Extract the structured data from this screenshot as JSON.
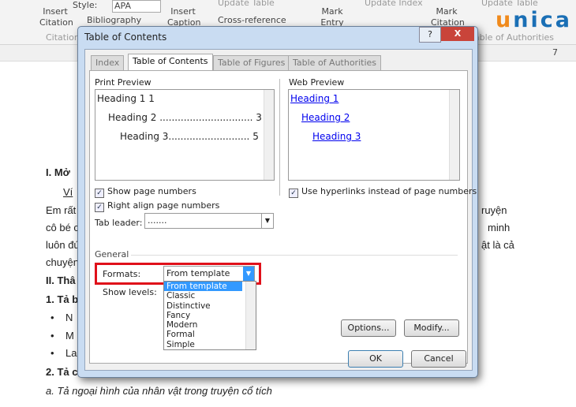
{
  "ribbon": {
    "style_label": "Style:",
    "style_value": "APA",
    "insert_citation": "Insert Citation",
    "bibliography": "Bibliography",
    "group_citations": "Citations",
    "insert_caption": "Insert Caption",
    "update_table_1": "Update Table",
    "cross_reference": "Cross-reference",
    "mark_entry": "Mark Entry",
    "update_index": "Update Index",
    "mark_citation": "Mark Citation",
    "update_table_2": "Update Table",
    "group_toa": "Table of Authorities",
    "ruler_num": "7"
  },
  "logo": "unica",
  "document": {
    "lines": [
      "I.  Mở",
      "Ví",
      "Em rất",
      "cô bé c",
      "luôn đú",
      "chuyện",
      "II.  Thâ",
      "1. Tả b",
      "N",
      "M",
      "La",
      "2. Tả c",
      "a. Tả ngoại hình của nhân vật trong truyện cổ tích"
    ],
    "right": [
      "ruyện",
      "minh",
      "ật là cả"
    ]
  },
  "dialog": {
    "title": "Table of Contents",
    "help": "?",
    "close": "X",
    "tabs": [
      "Index",
      "Table of Contents",
      "Table of Figures",
      "Table of Authorities"
    ],
    "print_preview": {
      "label": "Print Preview",
      "h1": "Heading 1 1",
      "h2": "Heading 2 ............................... 3",
      "h3": "Heading 3........................... 5"
    },
    "web_preview": {
      "label": "Web Preview",
      "h1": "Heading 1",
      "h2": "Heading 2",
      "h3": "Heading 3"
    },
    "show_page_numbers": "Show page numbers",
    "right_align": "Right align page numbers",
    "tab_leader_label": "Tab leader:",
    "tab_leader_value": ".......",
    "use_hyperlinks": "Use hyperlinks instead of page numbers",
    "general": "General",
    "formats_label": "Formats:",
    "formats_value": "From template",
    "show_levels_label": "Show levels:",
    "format_options": [
      "From template",
      "Classic",
      "Distinctive",
      "Fancy",
      "Modern",
      "Formal",
      "Simple"
    ],
    "options_btn": "Options...",
    "modify_btn": "Modify...",
    "ok_btn": "OK",
    "cancel_btn": "Cancel"
  },
  "colors": {
    "highlight": "#e0101a",
    "selection": "#3399ff",
    "logo_orange": "#f08a1c",
    "logo_blue": "#1a6fb5"
  }
}
